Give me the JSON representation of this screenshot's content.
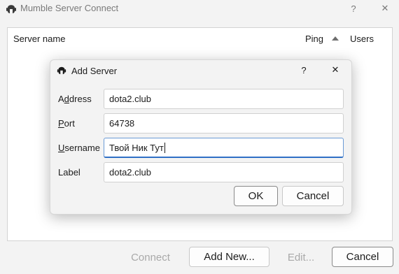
{
  "window": {
    "title": "Mumble Server Connect",
    "help_label": "?",
    "close_label": "✕"
  },
  "server_list": {
    "columns": {
      "name": "Server name",
      "ping": "Ping",
      "users": "Users"
    }
  },
  "footer": {
    "connect_label": "Connect",
    "add_new_label": "Add New...",
    "edit_label": "Edit...",
    "cancel_label": "Cancel"
  },
  "dialog": {
    "title": "Add Server",
    "help_label": "?",
    "close_label": "✕",
    "fields": {
      "address": {
        "label_pre": "A",
        "label_mnemonic": "d",
        "label_post": "dress",
        "value": "dota2.club"
      },
      "port": {
        "label_pre": "",
        "label_mnemonic": "P",
        "label_post": "ort",
        "value": "64738"
      },
      "username": {
        "label_pre": "",
        "label_mnemonic": "U",
        "label_post": "sername",
        "value": "Твой Ник Тут"
      },
      "label": {
        "label_pre": "Label",
        "label_mnemonic": "",
        "label_post": "",
        "value": "dota2.club"
      }
    },
    "ok_label": "OK",
    "cancel_label": "Cancel"
  },
  "colors": {
    "window_bg": "#f3f3f3",
    "focus_accent": "#2f6fc5",
    "disabled_text": "#a9a9a9"
  }
}
